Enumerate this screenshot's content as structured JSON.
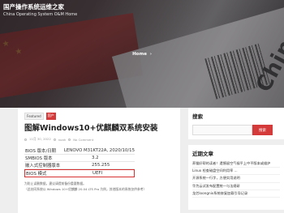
{
  "site": {
    "title": "国产操作系统运维之家",
    "description": "China Operating System O&M Home"
  },
  "breadcrumb": {
    "home": "Home",
    "separator": "›"
  },
  "article": {
    "categories": [
      "Featured",
      "国产"
    ],
    "title": "图解Windows10+优麒麟双系统安装",
    "meta": {
      "date": "11月 30, 2022",
      "author": "noah",
      "comments": "No Comment"
    },
    "bios_table": [
      {
        "key": "BIOS 版本/日期",
        "value": "LENOVO M31KT22A, 2020/10/15"
      },
      {
        "key": "SMBIOS 版本",
        "value": "3.2"
      },
      {
        "key": "嵌入式控制器版本",
        "value": "255.255"
      },
      {
        "key": "BIOS 模式",
        "value": "UEFI",
        "highlighted": true
      }
    ],
    "body_lines": [
      "为防止误删数据，建议请提前备份重要数据。",
      "（此处同系统以 Windows 10+优麒麟 20.04 LTS Pro 为例，其他版本的系统仅供参考）"
    ]
  },
  "sidebar": {
    "search": {
      "title": "搜索",
      "button": "搜索"
    },
    "recent": {
      "title": "近期文章",
      "items": [
        "养猫好帮的读者！遗憾留空气候平上中平版本或维护",
        "Linux 检查磁盘空间利用率 ...",
        "开源系统一行字，方便实用说明",
        "华为云试发布配置统一与法规研",
        "龙芯loongnix系统修复加载引导记录"
      ]
    }
  },
  "colors": {
    "accent": "#d43a3a",
    "highlight_border": "#d63030"
  }
}
